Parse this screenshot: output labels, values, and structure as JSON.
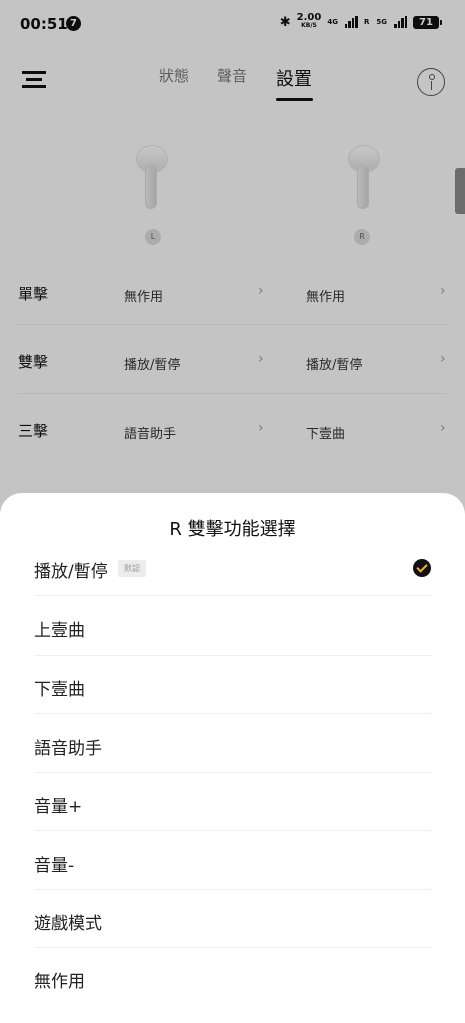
{
  "status_bar": {
    "time": "00:51",
    "notification_count": "7",
    "bluetooth_icon": "bluetooth-icon",
    "net_speed_value": "2.00",
    "net_speed_unit": "KB/S",
    "signal1_label": "4G",
    "signal2_label": "5G",
    "signal2_prefix": "R",
    "battery": "71"
  },
  "header": {
    "menu_icon": "menu-icon",
    "tabs": [
      {
        "label": "狀態",
        "active": false
      },
      {
        "label": "聲音",
        "active": false
      },
      {
        "label": "設置",
        "active": true
      }
    ],
    "info_icon": "info-icon"
  },
  "earbuds": {
    "left_label": "L",
    "right_label": "R"
  },
  "gesture_rows": [
    {
      "label": "單擊",
      "left_value": "無作用",
      "right_value": "無作用"
    },
    {
      "label": "雙擊",
      "left_value": "播放/暫停",
      "right_value": "播放/暫停"
    },
    {
      "label": "三擊",
      "left_value": "語音助手",
      "right_value": "下壹曲"
    }
  ],
  "sheet": {
    "title": "R 雙擊功能選擇",
    "default_tag": "默認",
    "options": [
      {
        "label": "播放/暫停",
        "selected": true
      },
      {
        "label": "上壹曲",
        "selected": false
      },
      {
        "label": "下壹曲",
        "selected": false
      },
      {
        "label": "語音助手",
        "selected": false
      },
      {
        "label": "音量+",
        "selected": false
      },
      {
        "label": "音量-",
        "selected": false
      },
      {
        "label": "遊戲模式",
        "selected": false
      },
      {
        "label": "無作用",
        "selected": false
      }
    ]
  },
  "colors": {
    "check_mark": "#f0b030",
    "sheet_bg": "#ffffff",
    "app_bg": "#f5f5f5"
  }
}
